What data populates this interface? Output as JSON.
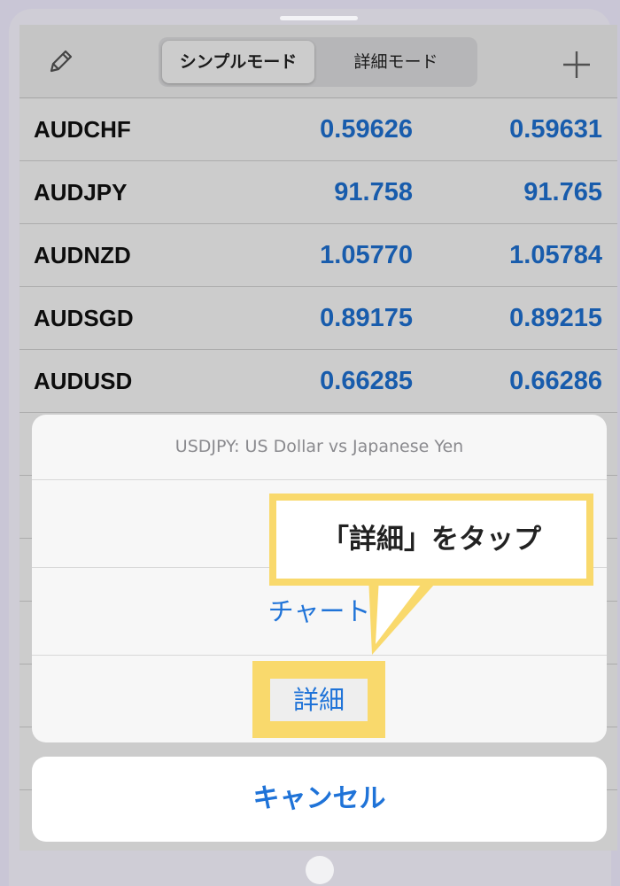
{
  "toolbar": {
    "edit_icon": "pencil-icon",
    "segments": [
      {
        "label": "シンプルモード",
        "selected": true
      },
      {
        "label": "詳細モード",
        "selected": false
      }
    ],
    "add_icon": "plus-icon"
  },
  "quotes": [
    {
      "symbol": "AUDCHF",
      "bid": "0.59626",
      "ask": "0.59631"
    },
    {
      "symbol": "AUDJPY",
      "bid": "91.758",
      "ask": "91.765"
    },
    {
      "symbol": "AUDNZD",
      "bid": "1.05770",
      "ask": "1.05784"
    },
    {
      "symbol": "AUDSGD",
      "bid": "0.89175",
      "ask": "0.89215"
    },
    {
      "symbol": "AUDUSD",
      "bid": "0.66285",
      "ask": "0.66286"
    }
  ],
  "action_sheet": {
    "title": "USDJPY: US Dollar vs Japanese Yen",
    "options": [
      "",
      "チャート",
      "詳細"
    ],
    "cancel_label": "キャンセル"
  },
  "annotation": {
    "callout_text": "「詳細」をタップ"
  },
  "colors": {
    "accent_blue": "#1f73d8",
    "highlight_yellow": "#f9d96c"
  }
}
